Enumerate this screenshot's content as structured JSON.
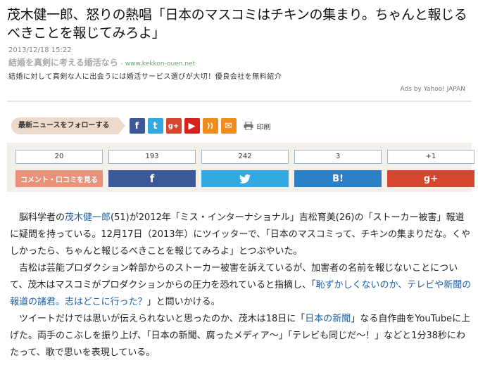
{
  "headline": "茂木健一郎、怒りの熱唱「日本のマスコミはチキンの集まり。ちゃんと報じるべきことを報じてみろよ」",
  "date": "2013/12/18 15:22",
  "ad": {
    "title": "結婚を真剣に考える婚活なら",
    "url": "- www.kekkon-ouen.net",
    "description": "結婚に対して真剣な人に出会うには婚活サービス選びが大切！優良会社を無料紹介",
    "ads_by": "Ads by Yahoo! JAPAN"
  },
  "follow": {
    "label": "最新ニュースをフォローする",
    "icons": [
      {
        "name": "facebook-icon",
        "glyph": "f",
        "color": "#3b5998"
      },
      {
        "name": "twitter-icon",
        "glyph": "t",
        "color": "#33a9e2"
      },
      {
        "name": "google-plus-icon",
        "glyph": "g+",
        "color": "#d5452f"
      },
      {
        "name": "youtube-icon",
        "glyph": "▶",
        "color": "#d6221b"
      },
      {
        "name": "rss-icon",
        "glyph": "))",
        "color": "#f08b1e"
      },
      {
        "name": "mail-icon",
        "glyph": "✉",
        "color": "#f08b1e"
      }
    ],
    "print_label": "印刷"
  },
  "share": {
    "comment": {
      "count": "20",
      "label": "コメント・口コミを見る",
      "color": "#e8927a"
    },
    "facebook": {
      "count": "193",
      "label": "f",
      "color": "#3b5998"
    },
    "twitter": {
      "count": "242",
      "label": "🐦",
      "color": "#33a9e2"
    },
    "hatena": {
      "count": "3",
      "label": "B!",
      "color": "#2a7fc6"
    },
    "google": {
      "count": "+1",
      "label": "g+",
      "color": "#d5452f"
    }
  },
  "article": {
    "p1_a": "脳科学者の",
    "p1_link": "茂木健一郎",
    "p1_b": "(51)が2012年「ミス・インターナショナル」吉松育美(26)の「ストーカー被害」報道に疑問を持っている。12月17日（2013年）にツイッターで、「日本のマスコミって、チキンの集まりだな。くやしかったら、ちゃんと報じるべきことを報じてみろよ」とつぶやいた。",
    "p2_a": "吉松は芸能プロダクション幹部からのストーカー被害を訴えているが、加害者の名前を報じないことについて、茂木はマスコミがプロダクションからの圧力を恐れていると指摘し、「",
    "p2_hl1": "恥ずかしくないのか、",
    "p2_link1": "テレビ",
    "p2_hl2": "や",
    "p2_link2": "新聞",
    "p2_hl3": "の報道の諸君。志はどこに行った？",
    "p2_b": "」と問いかける。",
    "p3_a": "ツイートだけでは思いが伝えられないと思ったのか、茂木は18日に「",
    "p3_link": "日本の新聞",
    "p3_b": "」なる自作曲をYouTubeに上げた。両手のこぶしを振り上げ、「日本の新聞、腐ったメディア〜」「テレビも同じだ〜！」などと1分38秒にわたって、歌で思いを表現している。"
  }
}
